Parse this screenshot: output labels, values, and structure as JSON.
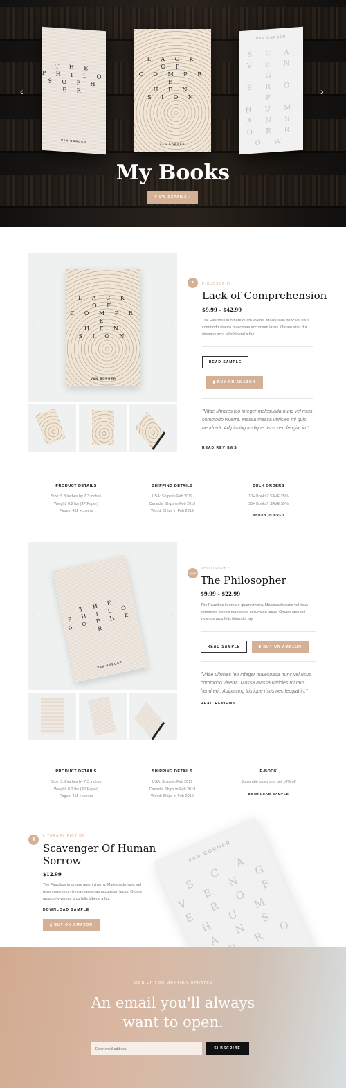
{
  "hero": {
    "title": "My Books",
    "button": "VIEW DETAILS ›",
    "books": [
      {
        "title_lines": [
          "T H E",
          "P H I L O",
          "S O P H E R"
        ],
        "author": "VAN BORGER"
      },
      {
        "title_lines": [
          "L A C K",
          "O F",
          "C O M P R E",
          "H E N",
          "S I O N"
        ],
        "author": "VAN BORGER"
      },
      {
        "title_lines": [
          "S C A",
          "V E N G",
          "E R O F",
          "H U M",
          "A N S",
          "O R R O W"
        ],
        "author": "VAN BORGER"
      }
    ]
  },
  "book1": {
    "category": "PHILOSOPHY",
    "title": "Lack of Comprehension",
    "price": "$9.99 – $42.99",
    "description": "The Faucibus in ornare quam viverra. Malesuada nunc vel risus commodo viverra maecenas accumsan lacus. Ornare arcu dui vivamus arcu felis bibend a fay.",
    "read_sample": "READ SAMPLE",
    "buy": "BUY ON AMAZON",
    "quote": "\"Vitae ultricies leo integer malesuada nunc vel risus commodo viverra. Massa massa ultricies mi quis hendrerit. Adipiscing tristique risus nec feugiat in.\"",
    "read_reviews": "READ REVIEWS",
    "cover_lines": [
      "L A C K",
      "O F",
      "C O M P R E",
      "H E N",
      "S I O N"
    ],
    "author": "VAN BORGER"
  },
  "details1": {
    "product": {
      "heading": "PRODUCT DETAILS",
      "lines": [
        "Size: 5.3 inches by 7.3 inches",
        "Weight: 0.2 lbs (JP Paper)",
        "Pages: 411 +covers"
      ]
    },
    "shipping": {
      "heading": "SHIPPING DETAILS",
      "lines": [
        "USA: Ships in Feb 2019",
        "Canada: Ships in Feb 2019",
        "World: Ships in Feb 2019"
      ]
    },
    "bulk": {
      "heading": "BULK ORDERS",
      "lines": [
        "10+ Books?  SAVE 25%",
        "50+ Books?  SAVE 35%"
      ],
      "link": "ORDER IN BULK"
    }
  },
  "book2": {
    "category": "PHILOSOPHY",
    "badge": "SALE",
    "title": "The Philosopher",
    "price": "$9.99 – $22.99",
    "description": "The Faucibus in ornare quam viverra. Malesuada nunc vel risus commodo viverra maecenas accumsan lacus. Ornare arcu dui vivamus arcu felis bibend a fay.",
    "read_sample": "READ SAMPLE",
    "buy": "BUY ON AMAZON",
    "quote": "\"Vitae ultricies leo integer malesuada nunc vel risus commodo viverra. Massa massa ultricies mi quis hendrerit. Adipiscing tristique risus nec feugiat in.\"",
    "read_reviews": "READ REVIEWS",
    "cover_lines": [
      "T H E",
      "P H I L O",
      "S O P H E R"
    ],
    "author": "VAN BORGER"
  },
  "details2": {
    "product": {
      "heading": "PRODUCT DETAILS",
      "lines": [
        "Size: 5.3 inches by 7.3 inches",
        "Weight: 0.2 lbs (JP Paper)",
        "Pages: 411 +covers"
      ]
    },
    "shipping": {
      "heading": "SHIPPING DETAILS",
      "lines": [
        "USA: Ships in Feb 2019",
        "Canada: Ships in Feb 2019",
        "World: Ships in Feb 2019"
      ]
    },
    "ebook": {
      "heading": "E-BOOK",
      "lines": [
        "Subscribe today and get 10% off"
      ],
      "link": "DOWNLOAD SAMPLE"
    }
  },
  "book3": {
    "category": "LITERARY FICTION",
    "title_line1": "Scavenger Of Human",
    "title_line2": "Sorrow",
    "price": "$12.99",
    "description": "The Faucibus in ornare quam viverra. Malesuada nunc vel risus commodo viverra maecenas accumsan lacus. Ornare arcu dui vivamus arcu felis bibend a fay.",
    "download": "DOWNLOAD SAMPLE",
    "buy": "BUY ON AMAZON",
    "author": "VAN BORGER",
    "cover_lines": [
      "S C A",
      "V E N G",
      "E R O F",
      "H U M",
      "A N S",
      "O R R O W"
    ]
  },
  "newsletter": {
    "subtitle": "SIGN UP FOR MONTHLY UPDATES",
    "title_line1": "An email you'll always",
    "title_line2": "want to open.",
    "placeholder": "Enter email address",
    "button": "SUBSCRIBE"
  },
  "colors": {
    "accent": "#d4b096",
    "dark": "#111111"
  }
}
